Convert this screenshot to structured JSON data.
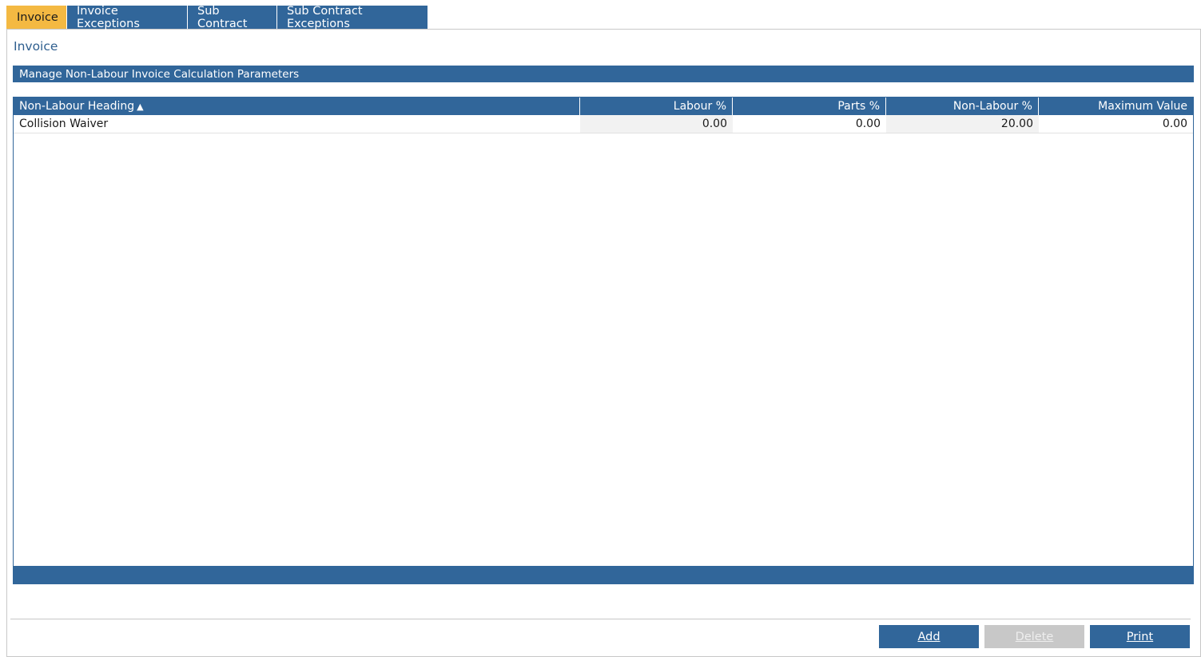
{
  "tabs": [
    {
      "label": "Invoice",
      "active": true
    },
    {
      "label": "Invoice Exceptions",
      "active": false
    },
    {
      "label": "Sub Contract",
      "active": false
    },
    {
      "label": "Sub Contract Exceptions",
      "active": false
    }
  ],
  "section": {
    "title": "Invoice",
    "bar_label": "Manage Non-Labour Invoice Calculation Parameters"
  },
  "grid": {
    "columns": [
      "Non-Labour Heading",
      "Labour %",
      "Parts %",
      "Non-Labour %",
      "Maximum Value"
    ],
    "sort_indicator": "▲",
    "rows": [
      [
        "Collision Waiver",
        "0.00",
        "0.00",
        "20.00",
        "0.00"
      ]
    ]
  },
  "buttons": {
    "add": "Add",
    "delete": "Delete",
    "print": "Print"
  },
  "colors": {
    "primary": "#31669a",
    "active_tab": "#f4b942",
    "disabled": "#c8c8c8"
  }
}
